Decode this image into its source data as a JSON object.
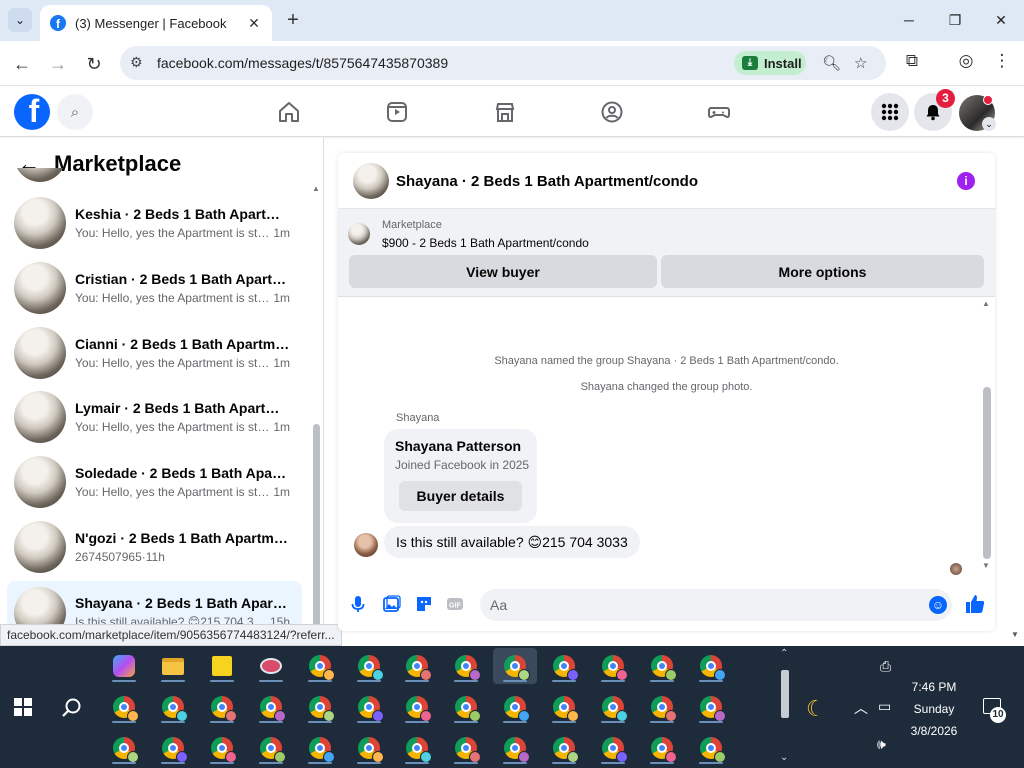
{
  "browser": {
    "tab_title": "(3) Messenger | Facebook",
    "tab_favicon_letter": "f",
    "new_tab": "+",
    "url": "facebook.com/messages/t/8575647435870389",
    "install_label": "Install",
    "status_url": "facebook.com/marketplace/item/9056356774483124/?referr..."
  },
  "fb_header": {
    "logo_letter": "f",
    "notification_count": "3"
  },
  "left_panel": {
    "title": "Marketplace",
    "conversations": [
      {
        "name": "Keshia · 2 Beds 1 Bath Apartmen...",
        "preview": "You: Hello, yes the Apartment is sti...",
        "time": "1m"
      },
      {
        "name": "Cristian · 2 Beds 1 Bath Apartme...",
        "preview": "You: Hello, yes the Apartment is sti...",
        "time": "1m"
      },
      {
        "name": "Cianni · 2 Beds 1 Bath Apartmen...",
        "preview": "You: Hello, yes the Apartment is sti...",
        "time": "1m"
      },
      {
        "name": "Lymair · 2 Beds 1 Bath Apartme...",
        "preview": "You: Hello, yes the Apartment is sti...",
        "time": "1m"
      },
      {
        "name": "Soledade · 2 Beds 1 Bath Apart...",
        "preview": "You: Hello, yes the Apartment is sti...",
        "time": "1m"
      },
      {
        "name": "N'gozi · 2 Beds 1 Bath Apartmen...",
        "preview": "2674507965",
        "time": "11h"
      },
      {
        "name": "Shayana · 2 Beds 1 Bath Apartm...",
        "preview": "Is this still available? 😊215 704 3...",
        "time": "15h"
      }
    ]
  },
  "chat": {
    "header_name": "Shayana · 2 Beds 1 Bath Apartment/condo",
    "info": "i",
    "marketplace_label": "Marketplace",
    "listing": "$900 - 2 Beds 1 Bath Apartment/condo",
    "view_buyer": "View buyer",
    "more_options": "More options",
    "system_messages": [
      "Shayana named the group Shayana · 2 Beds 1 Bath Apartment/condo.",
      "Shayana changed the group photo."
    ],
    "sender_label": "Shayana",
    "card_name": "Shayana Patterson",
    "card_joined": "Joined Facebook in 2025",
    "card_button": "Buyer details",
    "message": "Is this still available? 😊215 704 3033",
    "composer_placeholder": "Aa"
  },
  "taskbar": {
    "time": "7:46 PM",
    "day": "Sunday",
    "date": "3/8/2026",
    "notification_count": "10",
    "profile_colors": [
      "#7b61ff",
      "#f06292",
      "#9ccc65",
      "#42a5f5",
      "#ffb74d",
      "#4dd0e1",
      "#e57373",
      "#ba68c8",
      "#aed581"
    ]
  },
  "colors": {
    "fb_blue": "#0866ff",
    "active_row": "#ebf5ff",
    "badge_red": "#e41e3f",
    "info_purple": "#a020f0"
  }
}
